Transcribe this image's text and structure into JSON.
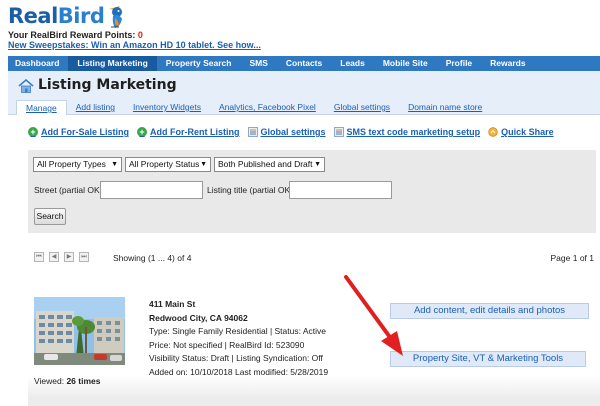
{
  "header": {
    "logo_text_a": "Real",
    "logo_text_b": "Bird",
    "reward_label": "Your RealBird Reward Points: ",
    "reward_points": "0",
    "sweepstakes": "New Sweepstakes: Win an Amazon HD 10 tablet. See how..."
  },
  "nav": {
    "items": [
      {
        "label": "Dashboard"
      },
      {
        "label": "Listing Marketing"
      },
      {
        "label": "Property Search"
      },
      {
        "label": "SMS"
      },
      {
        "label": "Contacts"
      },
      {
        "label": "Leads"
      },
      {
        "label": "Mobile Site"
      },
      {
        "label": "Profile"
      },
      {
        "label": "Rewards"
      }
    ],
    "active": "Listing Marketing"
  },
  "page": {
    "title": "Listing Marketing",
    "subtabs": [
      {
        "label": "Manage"
      },
      {
        "label": "Add listing"
      },
      {
        "label": "Inventory Widgets"
      },
      {
        "label": "Analytics, Facebook Pixel"
      },
      {
        "label": "Global settings"
      },
      {
        "label": "Domain name store"
      }
    ]
  },
  "actions": {
    "add_for_sale": "Add For-Sale Listing",
    "add_for_rent": "Add For-Rent Listing",
    "global_settings": "Global settings",
    "sms_setup": "SMS text code marketing setup",
    "quick_share": "Quick Share"
  },
  "filters": {
    "property_types": "All Property Types",
    "property_status": "All Property Status",
    "published": "Both Published and Draft",
    "street_label": "Street (partial OK):",
    "street_value": "",
    "title_label": "Listing title (partial OK):",
    "title_value": "",
    "search_button": "Search"
  },
  "pager": {
    "showing": "Showing (1 ... 4) of 4",
    "page_of": "Page 1 of 1"
  },
  "listing": {
    "address": "411 Main St",
    "city": "Redwood City, CA 94062",
    "type_line": "Type: Single Family Residential | Status: Active",
    "price_line": "Price: Not specified | RealBird Id: 523090",
    "visibility_line": "Visibility Status: Draft | Listing Syndication: Off",
    "dates_line": "Added on: 10/10/2018 Last modified: 5/28/2019",
    "viewed_label": "Viewed: ",
    "viewed_count": "26 times",
    "btn_add_content": "Add content, edit details and photos",
    "btn_property_site": "Property Site, VT & Marketing Tools"
  },
  "colors": {
    "nav_bg": "#2f78c2",
    "nav_active": "#185c9f",
    "link": "#1a5fb4",
    "annotation_arrow": "#e02020"
  }
}
